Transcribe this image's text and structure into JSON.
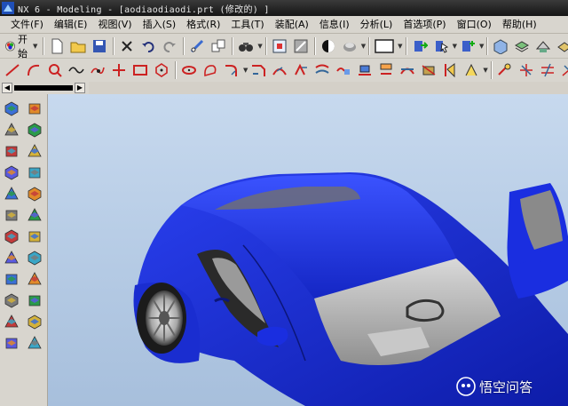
{
  "window": {
    "title": "NX 6 - Modeling - [aodiaodiaodi.prt  (修改的) ]"
  },
  "menu": [
    "文件(F)",
    "编辑(E)",
    "视图(V)",
    "插入(S)",
    "格式(R)",
    "工具(T)",
    "装配(A)",
    "信息(I)",
    "分析(L)",
    "首选项(P)",
    "窗口(O)",
    "帮助(H)"
  ],
  "toolbar": {
    "start_label": "开始"
  },
  "icons": {
    "row1": [
      "new-file-icon",
      "open-folder-icon",
      "save-icon",
      "close-x-icon",
      "undo-icon",
      "redo-icon",
      "cut-icon",
      "copy-icon",
      "binoculars-icon",
      "fit-view-icon",
      "zoom-icon",
      "render-style-icon",
      "shaded-icon",
      "color-swatch-icon",
      "edit-part-icon",
      "pointer-icon",
      "options-icon",
      "view-orient-icon",
      "layer-icon",
      "measure-icon",
      "analysis-icon"
    ],
    "row2": [
      "line-icon",
      "arc-icon",
      "circle-point-icon",
      "spline-icon",
      "point-icon",
      "cross-icon",
      "rectangle-icon",
      "polygon-icon",
      "ellipse-icon",
      "conic-icon",
      "fillet-icon",
      "chamfer-icon",
      "trim-icon",
      "extend-icon",
      "offset-icon",
      "mirror-icon",
      "pattern-icon",
      "project-icon",
      "intersect-icon",
      "derived-icon",
      "quick-trim-icon",
      "dimension-icon",
      "constraint-icon",
      "relation-icon"
    ],
    "sidebar": [
      "extrude-icon",
      "revolve-icon",
      "hole-icon",
      "boss-icon",
      "pocket-icon",
      "pad-icon",
      "slot-icon",
      "groove-icon",
      "block-icon",
      "cylinder-icon",
      "cone-icon",
      "sphere-icon",
      "unite-icon",
      "subtract-icon",
      "intersect-body-icon",
      "blend-icon",
      "chamfer-body-icon",
      "shell-icon",
      "draft-icon",
      "mirror-body-icon",
      "pattern-body-icon",
      "offset-face-icon",
      "sew-icon",
      "patch-icon"
    ]
  },
  "watermark": {
    "text": "悟空问答"
  },
  "colors": {
    "car_body": "#1c2fd8",
    "background_sky": "#b8cde6",
    "titlebar": "#1a1a1a"
  }
}
